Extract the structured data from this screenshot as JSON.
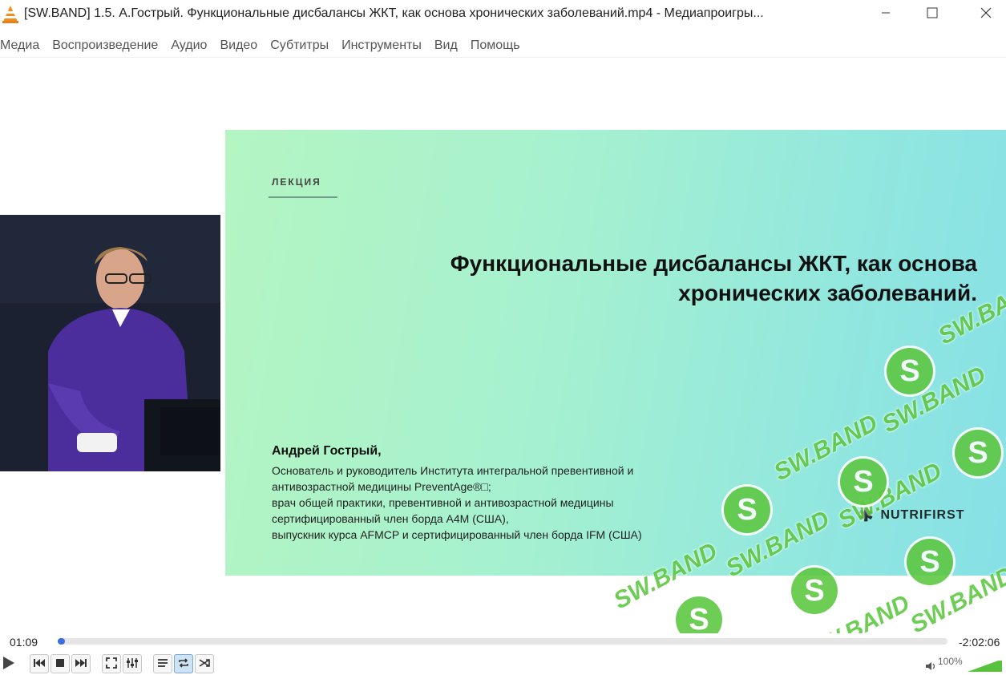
{
  "window": {
    "title": "[SW.BAND] 1.5. А.Гострый. Функциональные дисбалансы ЖКТ, как основа хронических заболеваний.mp4 - Медиапроигры...",
    "minimize_icon": "minimize-icon",
    "maximize_icon": "maximize-icon",
    "close_icon": "close-icon",
    "app_icon": "vlc-cone-icon"
  },
  "menu": {
    "items": [
      "Медиа",
      "Воспроизведение",
      "Аудио",
      "Видео",
      "Субтитры",
      "Инструменты",
      "Вид",
      "Помощь"
    ]
  },
  "slide": {
    "tag": "ЛЕКЦИЯ",
    "title_line1": "Функциональные дисбалансы ЖКТ, как основа",
    "title_line2": "хронических заболеваний.",
    "speaker_name": "Андрей Гострый,",
    "bio": [
      "Основатель и руководитель Института интегральной превентивной и",
      "антивозрастной медицины PreventAge®□;",
      "врач общей практики, превентивной и антивозрастной медицины",
      "сертифицированный член борда A4M (США),",
      "выпускник курса  AFMCP и сертифицированный член борда IFM (США)"
    ],
    "brand": "NUTRIFIRST"
  },
  "watermark": {
    "text": "SW.BAND",
    "badge": "S"
  },
  "player": {
    "time_elapsed": "01:09",
    "time_remaining": "-2:02:06",
    "progress_fraction": 0.008,
    "volume_label": "100%",
    "volume_fraction": 1.0,
    "accent_color": "#3a6ede",
    "volume_color": "#58c13e"
  },
  "controls": {
    "play_icon": "play-icon",
    "prev_icon": "previous-icon",
    "stop_icon": "stop-icon",
    "next_icon": "next-icon",
    "fullscreen_icon": "fullscreen-icon",
    "extended_icon": "extended-settings-icon",
    "playlist_icon": "playlist-icon",
    "loop_icon": "loop-icon",
    "shuffle_icon": "shuffle-icon",
    "volume_icon": "volume-icon"
  }
}
